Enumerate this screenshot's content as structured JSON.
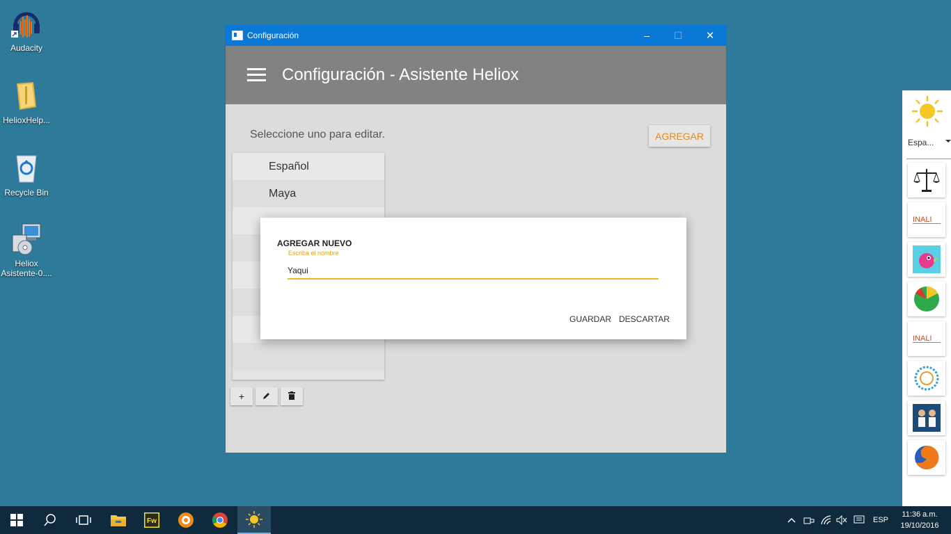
{
  "desktop": {
    "icons": [
      {
        "label": "Audacity"
      },
      {
        "label": "HelioxHelp..."
      },
      {
        "label": "Recycle Bin"
      },
      {
        "label": "Heliox Asistente-0...."
      }
    ]
  },
  "window": {
    "title": "Configuración",
    "controls": {
      "minimize": "–",
      "maximize": "☐",
      "close": "✕"
    },
    "appbar_title": "Configuración - Asistente Heliox",
    "prompt": "Seleccione uno para editar.",
    "add_button": "AGREGAR",
    "list_items": [
      "Español",
      "Maya",
      "",
      "",
      "",
      "",
      "",
      "",
      ""
    ],
    "tools": {
      "add": "+",
      "edit": "✎",
      "delete": "🗑"
    }
  },
  "dialog": {
    "title": "AGREGAR NUEVO",
    "hint": "Escriba el nombre",
    "value": "Yaqui",
    "save": "GUARDAR",
    "discard": "DESCARTAR"
  },
  "sidepanel": {
    "language": "Espa..."
  },
  "taskbar": {
    "tray_lang": "ESP",
    "time": "11:36 a.m.",
    "date": "19/10/2016"
  },
  "colors": {
    "desktop": "#2d7a9a",
    "titlebar": "#0a78d7",
    "appbar": "#828282",
    "accent": "#e08a1c",
    "input_underline": "#f0b823"
  }
}
